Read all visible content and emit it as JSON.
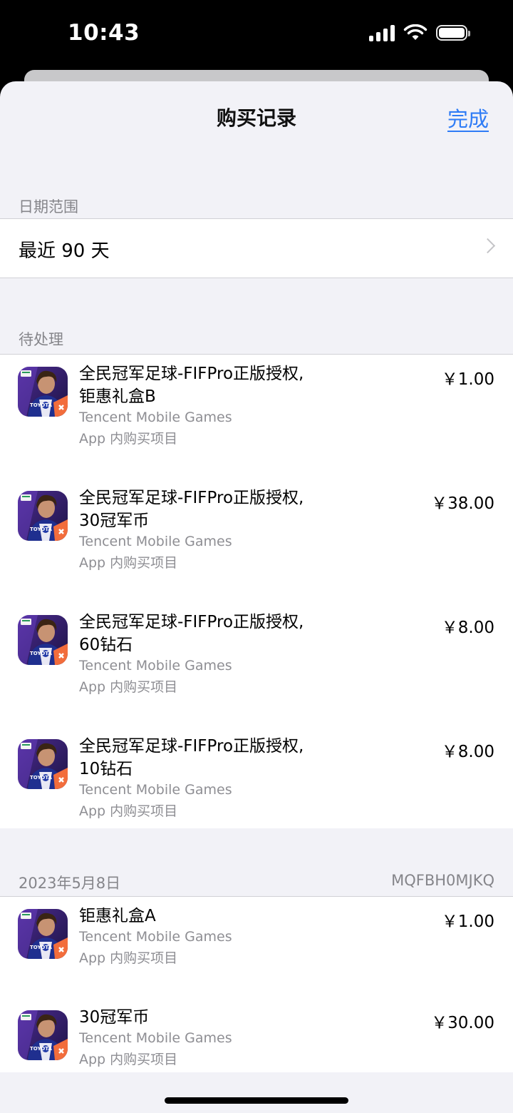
{
  "status_bar": {
    "time": "10:43",
    "icons": [
      "signal-icon",
      "wifi-icon",
      "battery-icon"
    ]
  },
  "nav": {
    "title": "购买记录",
    "done": "完成"
  },
  "date_range": {
    "header": "日期范围",
    "value": "最近 90 天"
  },
  "pending": {
    "header": "待处理",
    "items": [
      {
        "title": "全民冠军足球-FIFPro正版授权,\n钜惠礼盒B",
        "developer": "Tencent Mobile Games",
        "type": "App 内购买项目",
        "price": "￥1.00"
      },
      {
        "title": "全民冠军足球-FIFPro正版授权,\n30冠军币",
        "developer": "Tencent Mobile Games",
        "type": "App 内购买项目",
        "price": "￥38.00"
      },
      {
        "title": "全民冠军足球-FIFPro正版授权,\n60钻石",
        "developer": "Tencent Mobile Games",
        "type": "App 内购买项目",
        "price": "￥8.00"
      },
      {
        "title": "全民冠军足球-FIFPro正版授权,\n10钻石",
        "developer": "Tencent Mobile Games",
        "type": "App 内购买项目",
        "price": "￥8.00"
      }
    ]
  },
  "dated": {
    "date": "2023年5月8日",
    "order_id": "MQFBH0MJKQ",
    "items": [
      {
        "title": "钜惠礼盒A",
        "developer": "Tencent Mobile Games",
        "type": "App 内购买项目",
        "price": "￥1.00"
      },
      {
        "title": "30冠军币",
        "developer": "Tencent Mobile Games",
        "type": "App 内购买项目",
        "price": "￥30.00"
      }
    ]
  },
  "colors": {
    "accent": "#2f7cf6",
    "grouped_bg": "#f2f2f7",
    "secondary_text": "#8e8e93"
  }
}
